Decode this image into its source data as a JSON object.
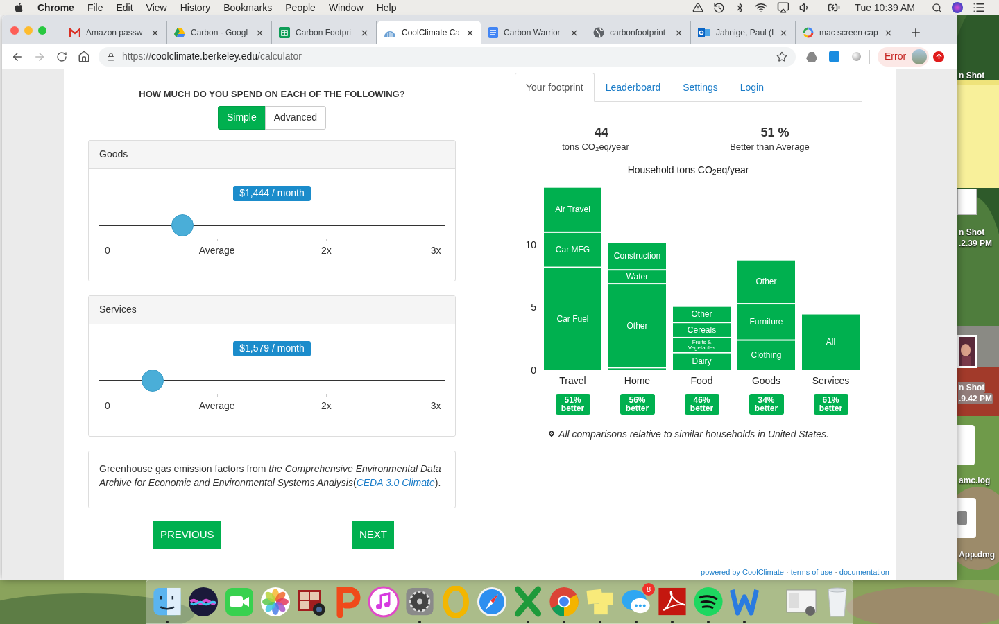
{
  "menu_bar": {
    "items": [
      {
        "label": "Chrome",
        "kind": "app"
      },
      {
        "label": "File",
        "kind": "menu"
      },
      {
        "label": "Edit",
        "kind": "menu"
      },
      {
        "label": "View",
        "kind": "menu"
      },
      {
        "label": "History",
        "kind": "menu"
      },
      {
        "label": "Bookmarks",
        "kind": "menu"
      },
      {
        "label": "People",
        "kind": "menu"
      },
      {
        "label": "Window",
        "kind": "menu"
      },
      {
        "label": "Help",
        "kind": "menu"
      }
    ],
    "clock": "Tue 10:39 AM"
  },
  "browser": {
    "tabs": [
      {
        "title": "Amazon passw",
        "kind": "mail",
        "selected": false
      },
      {
        "title": "Carbon - Googl",
        "kind": "drive",
        "selected": false
      },
      {
        "title": "Carbon Footpri",
        "kind": "sheet",
        "selected": false
      },
      {
        "title": "CoolClimate Ca",
        "kind": "dome",
        "selected": true
      },
      {
        "title": "Carbon Warrior",
        "kind": "doc",
        "selected": false
      },
      {
        "title": "carbonfootprint",
        "kind": "globe",
        "selected": false
      },
      {
        "title": "Jahnige, Paul (I",
        "kind": "outlook",
        "selected": false
      },
      {
        "title": "mac screen cap",
        "kind": "google",
        "selected": false
      }
    ],
    "address": {
      "scheme": "https://",
      "host": "coolclimate.berkeley.edu",
      "path": "/calculator"
    },
    "profile_status": "Error"
  },
  "calculator": {
    "question": "HOW MUCH DO YOU SPEND ON EACH OF THE FOLLOWING?",
    "modes": [
      {
        "label": "Simple",
        "selected": true
      },
      {
        "label": "Advanced",
        "selected": false
      }
    ],
    "sliders": [
      {
        "title": "Goods",
        "value": "$1,444 / month",
        "level": 0.24,
        "ticks": [
          "0",
          "Average",
          "2x",
          "3x"
        ]
      },
      {
        "title": "Services",
        "value": "$1,579 / month",
        "level": 0.155,
        "ticks": [
          "0",
          "Average",
          "2x",
          "3x"
        ]
      }
    ],
    "source_note": {
      "text": "Greenhouse gas emission factors from *the Comprehensive Environmental Data Archive for Economic and Environmental Systems Analysis*(",
      "link": "CEDA 3.0 Climate",
      "end": ")."
    },
    "buttons": [
      "PREVIOUS",
      "NEXT"
    ]
  },
  "results": {
    "tabs": [
      {
        "label": "Your footprint",
        "selected": true
      },
      {
        "label": "Leaderboard",
        "selected": false
      },
      {
        "label": "Settings",
        "selected": false
      },
      {
        "label": "Login",
        "selected": false
      }
    ],
    "stats": [
      {
        "value": "44",
        "label": "tons CO$_{2}$eq/year"
      },
      {
        "value": "51 %",
        "label": "Better than Average"
      }
    ],
    "chart_data": {
      "type": "bar",
      "title": "Household tons CO$_{2}$eq/year",
      "stacked": true,
      "categories": [
        "Travel",
        "Home",
        "Food",
        "Goods",
        "Services"
      ],
      "ylim": [
        0,
        14.6
      ],
      "yticks": [
        0,
        5,
        10
      ],
      "series": [
        {
          "name": "Car Fuel",
          "color": "#00b04f",
          "values": [
            8.2,
            null,
            null,
            null,
            null
          ]
        },
        {
          "name": "Car MFG",
          "color": "#00b04f",
          "values": [
            2.8,
            null,
            null,
            null,
            null
          ]
        },
        {
          "name": "Air Travel",
          "color": "#00b04f",
          "values": [
            3.6,
            null,
            null,
            null,
            null
          ]
        },
        {
          "color": "#00b04f",
          "values": [
            null,
            0.2,
            null,
            null,
            null
          ]
        },
        {
          "name": "Other",
          "color": "#00b04f",
          "values": [
            null,
            6.7,
            null,
            null,
            null
          ]
        },
        {
          "name": "Water",
          "color": "#00b04f",
          "values": [
            null,
            1.1,
            null,
            null,
            null
          ]
        },
        {
          "name": "Construction",
          "color": "#00b04f",
          "values": [
            null,
            2.2,
            null,
            null,
            null
          ]
        },
        {
          "name": "Dairy",
          "color": "#00b04f",
          "values": [
            null,
            null,
            1.4,
            null,
            null
          ]
        },
        {
          "name": "Fruits & Vegetables",
          "color": "#00b04f",
          "values": [
            null,
            null,
            1.2,
            null,
            null
          ]
        },
        {
          "name": "Cereals",
          "color": "#00b04f",
          "values": [
            null,
            null,
            1.2,
            null,
            null
          ]
        },
        {
          "name": "Other",
          "color": "#00b04f",
          "values": [
            null,
            null,
            1.3,
            null,
            null
          ]
        },
        {
          "name": "Clothing",
          "color": "#00b04f",
          "values": [
            null,
            null,
            null,
            2.4,
            null
          ]
        },
        {
          "name": "Furniture",
          "color": "#00b04f",
          "values": [
            null,
            null,
            null,
            2.9,
            null
          ]
        },
        {
          "name": "Other",
          "color": "#00b04f",
          "values": [
            null,
            null,
            null,
            3.5,
            null
          ]
        },
        {
          "name": "All",
          "color": "#00b04f",
          "values": [
            null,
            null,
            null,
            null,
            4.5
          ]
        }
      ]
    },
    "comparisons": [
      "51% better",
      "56% better",
      "46% better",
      "34% better",
      "61% better"
    ],
    "footnote": "All comparisons relative to similar households in United States."
  },
  "footer": {
    "links": [
      "powered by CoolClimate",
      "terms of use",
      "documentation"
    ],
    "separator": "·"
  },
  "desktop": {
    "icons": [
      {
        "label": "n Shot",
        "selected": false
      },
      {
        "label": "n Shot",
        "sublabel": ".2.39 PM",
        "selected": false
      },
      {
        "label": "n Shot",
        "sublabel": ".9.42 PM",
        "selected": true
      },
      {
        "label": "amc.log",
        "selected": false
      },
      {
        "label": "App.dmg",
        "selected": false
      }
    ]
  },
  "dock": {
    "apps": [
      {
        "kind": "finder",
        "running": true
      },
      {
        "kind": "siri",
        "running": false
      },
      {
        "kind": "facetime",
        "running": false
      },
      {
        "kind": "photos",
        "running": false
      },
      {
        "kind": "photobooth",
        "running": false
      },
      {
        "kind": "presenter",
        "running": false
      },
      {
        "kind": "music",
        "running": false
      },
      {
        "kind": "settings",
        "running": true
      },
      {
        "kind": "ring",
        "running": false
      },
      {
        "kind": "safari",
        "running": false
      },
      {
        "kind": "spreadsheet",
        "running": true
      },
      {
        "kind": "chrome",
        "running": true
      },
      {
        "kind": "stickies",
        "running": true
      },
      {
        "kind": "messages",
        "running": true,
        "badge": "8"
      },
      {
        "kind": "acrobat",
        "running": true
      },
      {
        "kind": "spotify",
        "running": true
      },
      {
        "kind": "word",
        "running": true
      }
    ],
    "others": [
      {
        "kind": "preview",
        "running": false
      },
      {
        "kind": "trash",
        "running": false
      }
    ]
  }
}
